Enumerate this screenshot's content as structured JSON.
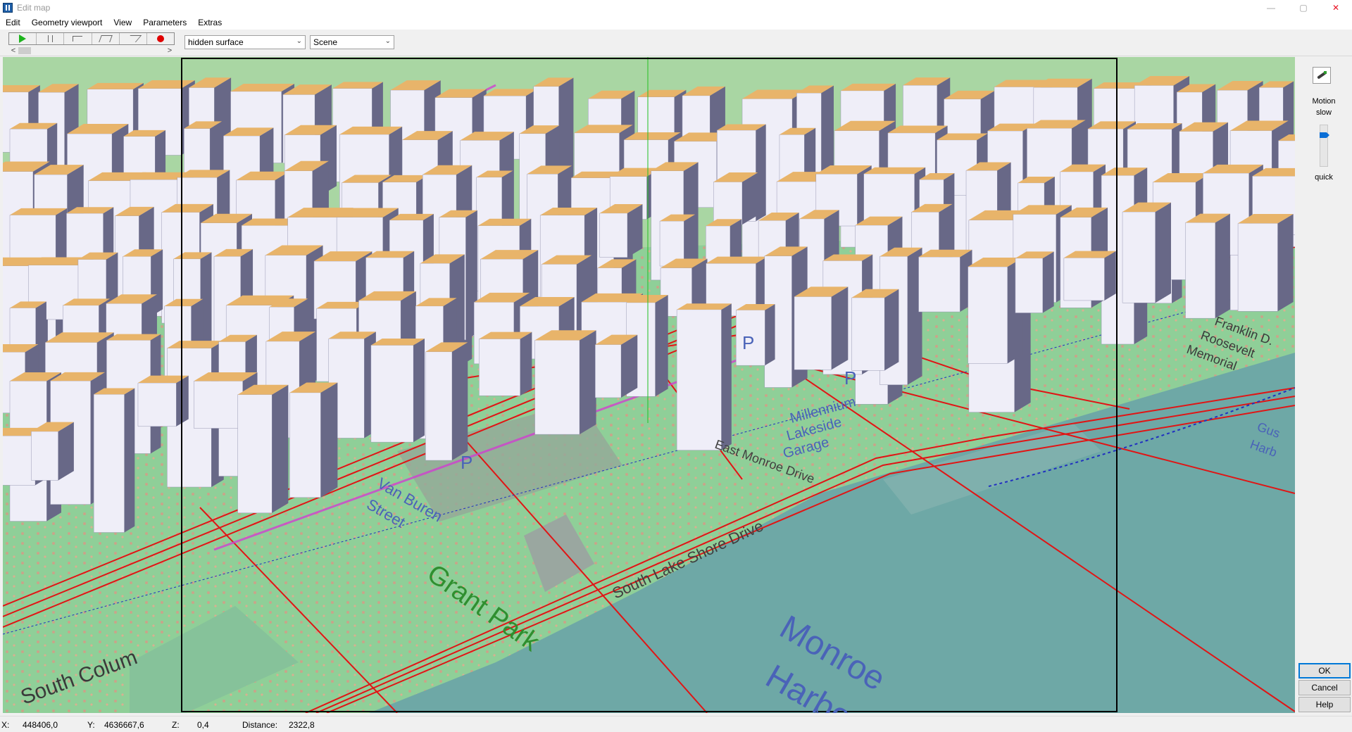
{
  "window": {
    "title": "Edit map",
    "min": "—",
    "max": "▢",
    "close": "✕"
  },
  "menu": [
    "Edit",
    "Geometry viewport",
    "View",
    "Parameters",
    "Extras"
  ],
  "toolbar": {
    "render_mode": "hidden surface",
    "view_mode": "Scene",
    "scroll_left": "<",
    "scroll_right": ">",
    "chevron": "⌄"
  },
  "map_labels": {
    "park": "Grant Park",
    "harbor_line1": "Monroe",
    "harbor_line2": "Harbor",
    "garage_line1": "Millennium",
    "garage_line2": "Lakeside",
    "garage_line3": "Garage",
    "drive1": "South Lake Shore Drive",
    "drive2": "East Monroe Drive",
    "street1": "Van Buren",
    "street2": "Street",
    "parking": "P",
    "south_edge": "South Colum",
    "roosevelt1": "Franklin D.",
    "roosevelt2": "Roosevelt",
    "roosevelt3": "Memorial",
    "east_label1": "Gus",
    "east_label2": "Harb"
  },
  "side": {
    "motion": "Motion",
    "slow": "slow",
    "quick": "quick"
  },
  "buttons": {
    "ok": "OK",
    "cancel": "Cancel",
    "help": "Help"
  },
  "status": {
    "x_label": "X:",
    "x_value": "448406,0",
    "y_label": "Y:",
    "y_value": "4636667,6",
    "z_label": "Z:",
    "z_value": "0,4",
    "dist_label": "Distance:",
    "dist_value": "2322,8"
  }
}
